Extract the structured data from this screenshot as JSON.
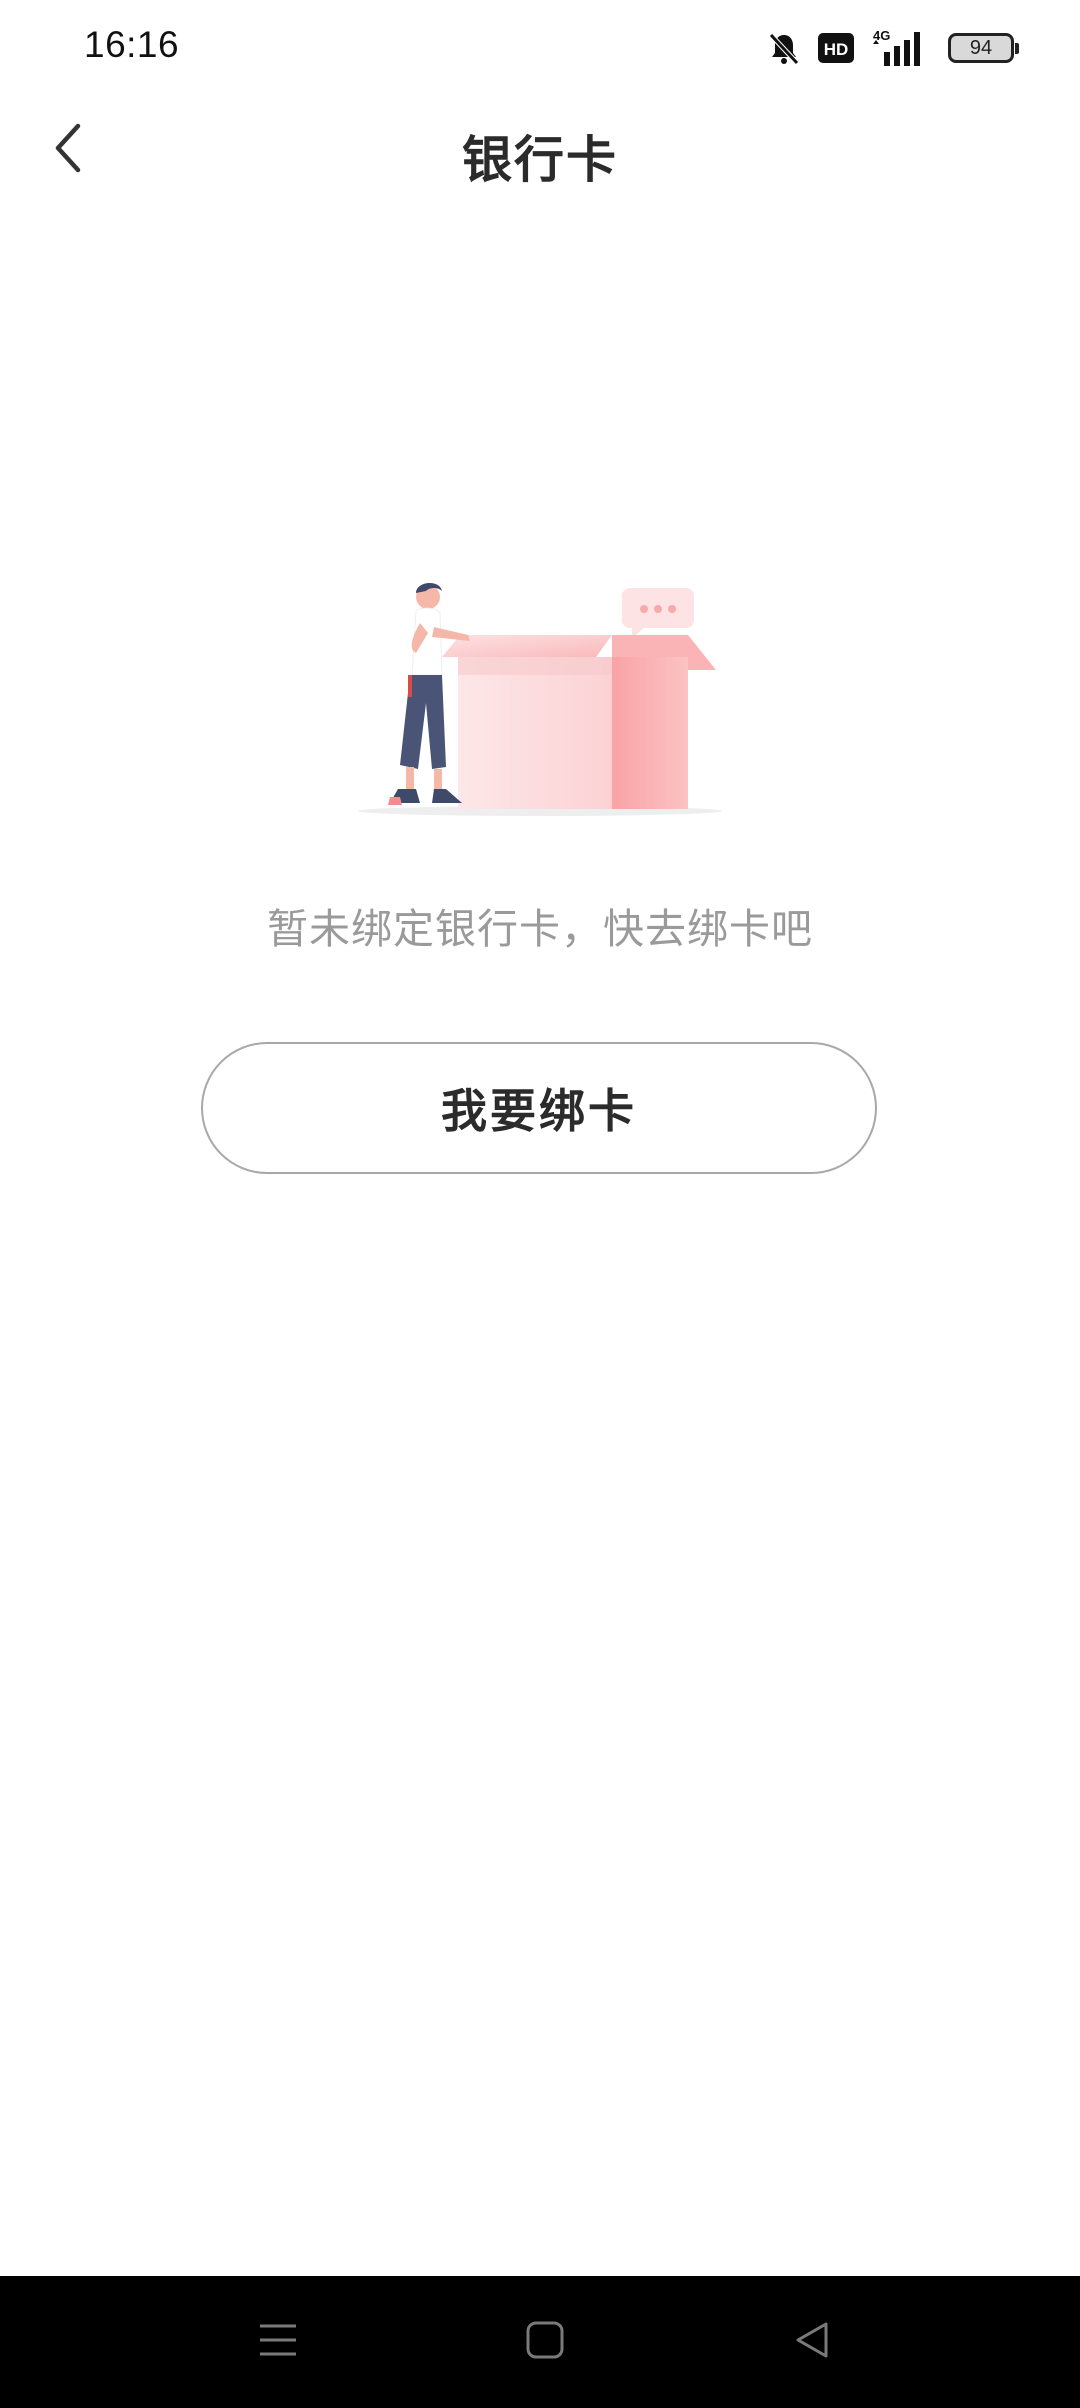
{
  "status_bar": {
    "time": "16:16",
    "hd_label": "HD",
    "network_label": "4G",
    "battery_level": "94",
    "icons": [
      "mute-icon",
      "hd-icon",
      "signal-icon",
      "battery-icon"
    ]
  },
  "header": {
    "title": "银行卡",
    "back_icon": "chevron-left-icon"
  },
  "empty_state": {
    "illustration": "person-with-open-box-illustration",
    "message": "暂未绑定银行卡，快去绑卡吧",
    "button_label": "我要绑卡"
  },
  "nav_bar": {
    "icons": [
      "menu-icon",
      "home-icon",
      "back-triangle-icon"
    ]
  },
  "colors": {
    "accent_pink": "#f9a3a5",
    "text_primary": "#2b2b2b",
    "text_secondary": "#9a9a9a",
    "button_border": "#a8a8a8"
  }
}
